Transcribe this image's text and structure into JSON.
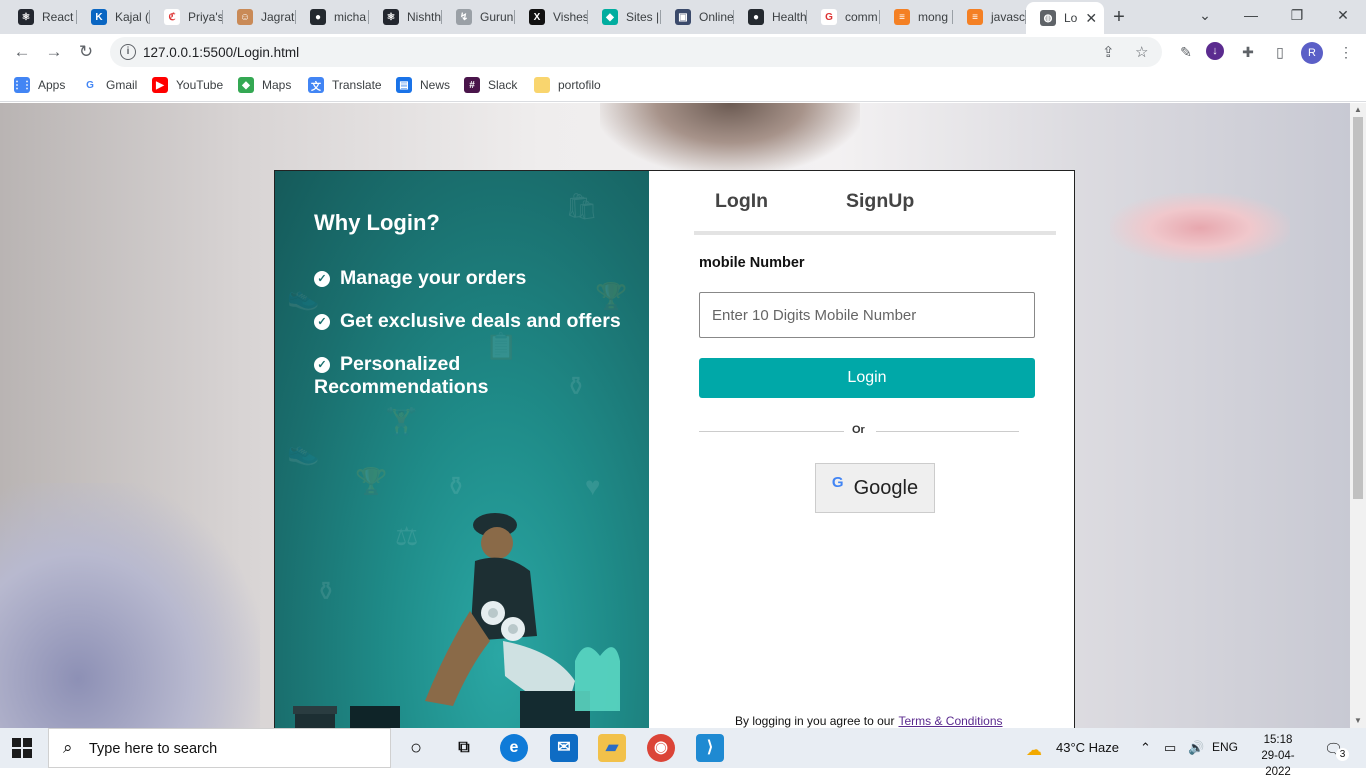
{
  "browser": {
    "tabs": [
      {
        "title": "React",
        "fav_color": "#23272f",
        "fav_glyph": "⚛"
      },
      {
        "title": "Kajal (",
        "fav_color": "#0a66c2",
        "fav_glyph": "K"
      },
      {
        "title": "Priya's",
        "fav_color": "#ffffff",
        "fav_glyph": "ℭ"
      },
      {
        "title": "Jagrat",
        "fav_color": "#c98a57",
        "fav_glyph": "☺"
      },
      {
        "title": "micha",
        "fav_color": "#24292f",
        "fav_glyph": "●"
      },
      {
        "title": "Nishth",
        "fav_color": "#23272f",
        "fav_glyph": "⚛"
      },
      {
        "title": "Gurun",
        "fav_color": "#9aa0a6",
        "fav_glyph": "↯"
      },
      {
        "title": "Vishes",
        "fav_color": "#111111",
        "fav_glyph": "X"
      },
      {
        "title": "Sites |",
        "fav_color": "#00ad9f",
        "fav_glyph": "◆"
      },
      {
        "title": "Online",
        "fav_color": "#3b4a6b",
        "fav_glyph": "▣"
      },
      {
        "title": "Health",
        "fav_color": "#24292f",
        "fav_glyph": "●"
      },
      {
        "title": "comm",
        "fav_color": "#ffffff",
        "fav_glyph": "G"
      },
      {
        "title": "mong",
        "fav_color": "#f48024",
        "fav_glyph": "≡"
      },
      {
        "title": "javasc",
        "fav_color": "#f48024",
        "fav_glyph": "≡"
      },
      {
        "title": "Lo",
        "fav_color": "#5f6368",
        "fav_glyph": "◍",
        "active": true
      }
    ],
    "new_tab_label": "+",
    "window_controls": {
      "chevron": "⌄",
      "minimize": "—",
      "restore": "❐",
      "close": "✕"
    },
    "url": "127.0.0.1:5500/Login.html",
    "profile_initial": "R",
    "bookmarks": [
      {
        "label": "Apps",
        "color": "#4285f4",
        "glyph": "⋮⋮"
      },
      {
        "label": "Gmail",
        "color": "#ffffff",
        "glyph": "G"
      },
      {
        "label": "YouTube",
        "color": "#ff0000",
        "glyph": "▶"
      },
      {
        "label": "Maps",
        "color": "#34a853",
        "glyph": "◆"
      },
      {
        "label": "Translate",
        "color": "#4285f4",
        "glyph": "文"
      },
      {
        "label": "News",
        "color": "#1a73e8",
        "glyph": "▤"
      },
      {
        "label": "Slack",
        "color": "#4a154b",
        "glyph": "#"
      },
      {
        "label": "portofilo",
        "color": "#f9d56e",
        "glyph": ""
      }
    ]
  },
  "page": {
    "promo": {
      "heading": "Why Login?",
      "points": [
        "Manage your orders",
        "Get exclusive deals and offers",
        "Personalized Recommendations"
      ]
    },
    "form": {
      "tab_login": "LogIn",
      "tab_signup": "SignUp",
      "mobile_label": "mobile Number",
      "mobile_placeholder": "Enter 10 Digits Mobile Number",
      "mobile_value": "",
      "login_button": "Login",
      "divider": "Or",
      "google_button": "Google",
      "terms_prefix": "By logging in you agree to our",
      "terms_link": "Terms & Conditions"
    },
    "accent_color": "#00a8a8"
  },
  "taskbar": {
    "search_text": "Type here to search",
    "weather": "43°C  Haze",
    "language": "ENG",
    "time": "15:18",
    "date": "29-04-2022",
    "notifications": "3"
  }
}
